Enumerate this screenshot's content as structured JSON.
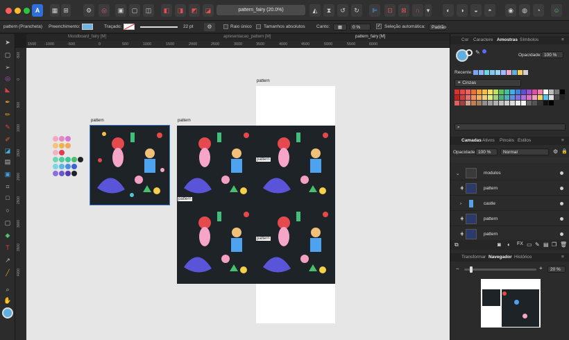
{
  "window": {
    "title": "pattern_fairy (20.0%)"
  },
  "context_bar": {
    "selection": "pattern (Prancheta)",
    "fill_label": "Preenchimento:",
    "stroke_label": "Traçado:",
    "stroke_width": "22 pt",
    "single_radius": "Raio único",
    "absolute_sizes": "Tamanhos absolutos",
    "corner_label": "Canto:",
    "corner_value": "0 %",
    "auto_select": "Seleção automática:",
    "auto_select_value": "Padrão"
  },
  "doc_tabs": [
    "Moodboard_fairy [M]",
    "apresentacao_pattern [M]",
    "pattern_fairy [M]"
  ],
  "ruler_top": [
    "1500",
    "-1000",
    "-500",
    "0",
    "500",
    "1000",
    "1500",
    "2000",
    "2500",
    "3000",
    "3500",
    "4000",
    "4500",
    "5000",
    "5500",
    "6000"
  ],
  "ruler_left": [
    "-500",
    "0",
    "500",
    "1000",
    "1500",
    "2000",
    "2500",
    "3000",
    "3500",
    "4000"
  ],
  "canvas": {
    "art1_label": "pattern",
    "art2_label": "pattern",
    "art3_label": "pattern",
    "inner_label_1": "pattern",
    "inner_label_2": "pattern",
    "inner_label_3": "pattern"
  },
  "swatches_panel": {
    "tabs": [
      "Cor",
      "Caractere",
      "Amostras",
      "Símbolos"
    ],
    "active_tab": "Amostras",
    "opacity_label": "Opacidade:",
    "opacity_value": "100 %",
    "recent_label": "Recente:",
    "palette_name": "Cinzas"
  },
  "layers_panel": {
    "tabs": [
      "Camadas",
      "Ativos",
      "Pincéis",
      "Estilos"
    ],
    "active_tab": "Camadas",
    "opacity_label": "Opacidade:",
    "opacity_value": "100 %",
    "blend_mode": "Normal",
    "layers": [
      {
        "name": "modulos"
      },
      {
        "name": "pattern"
      },
      {
        "name": "castle"
      },
      {
        "name": "pattern"
      },
      {
        "name": "pattern"
      }
    ]
  },
  "navigator_panel": {
    "tabs": [
      "Transformar",
      "Navegador",
      "Histórico"
    ],
    "active_tab": "Navegador",
    "zoom_value": "20 %"
  },
  "colors": {
    "accent": "#3a8ad8",
    "fill_swatch": "#6fb4e0",
    "pattern_bg": "#1d2326"
  }
}
